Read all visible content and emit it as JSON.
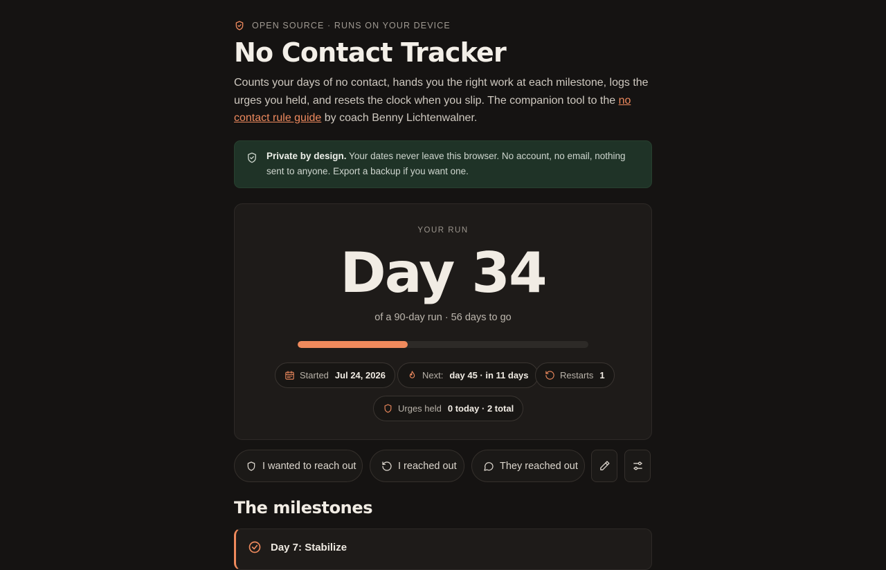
{
  "header": {
    "eyebrow": "OPEN SOURCE · RUNS ON YOUR DEVICE",
    "title": "No Contact Tracker",
    "intro_before": "Counts your days of no contact, hands you the right work at each milestone, logs the urges you held, and resets the clock when you slip. The companion tool to the ",
    "intro_link": "no contact rule guide",
    "intro_after": " by coach Benny Lichtenwalner."
  },
  "privacy": {
    "strong": "Private by design.",
    "text": " Your dates never leave this browser. No account, no email, nothing sent to anyone. Export a backup if you want one."
  },
  "run": {
    "label": "YOUR RUN",
    "day": "Day 34",
    "subtitle": "of a 90-day run · 56 days to go",
    "progress_fraction": 0.3778,
    "started_label": "Started",
    "started_value": "Jul 24, 2026",
    "next_label": "Next:",
    "next_value": "day 45 · in 11 days",
    "restarts_label": "Restarts",
    "restarts_value": "1",
    "urges_label": "Urges held",
    "urges_value": "0 today · 2 total"
  },
  "actions": {
    "wanted": "I wanted to reach out",
    "reached": "I reached out",
    "they": "They reached out",
    "edit_icon": "pencil-icon",
    "settings_icon": "sliders-icon"
  },
  "milestones": {
    "heading": "The milestones",
    "items": [
      {
        "title": "Day 7: Stabilize"
      }
    ]
  },
  "colors": {
    "accent": "#f08a5c",
    "background": "#151312",
    "card": "#1e1b19",
    "privacy_bg": "#1f3327"
  }
}
